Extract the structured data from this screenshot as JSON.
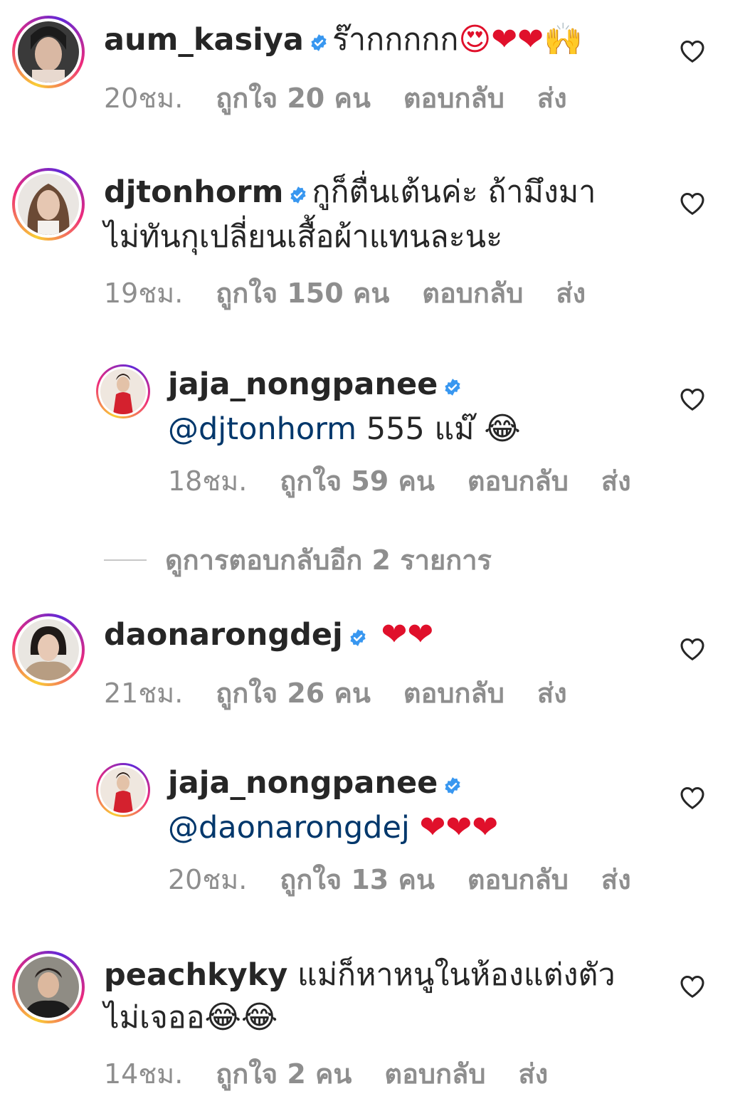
{
  "comments": [
    {
      "username": "aum_kasiya",
      "text": "ร๊ากกกกก",
      "emojis": "😍❤❤🙌",
      "time": "20ชม.",
      "likes": "ถูกใจ 20 คน",
      "reply": "ตอบกลับ",
      "send": "ส่ง"
    },
    {
      "username": "djtonhorm",
      "text_line1": "กูก็ตื่นเต้นค่ะ ถ้ามึงมา",
      "text_line2": "ไม่ทันกุเปลี่ยนเสื้อผ้าแทนละนะ",
      "time": "19ชม.",
      "likes": "ถูกใจ 150 คน",
      "reply": "ตอบกลับ",
      "send": "ส่ง"
    },
    {
      "username": "jaja_nongpanee",
      "mention": "@djtonhorm",
      "text": " 555 แม๊",
      "emojis": "😂",
      "time": "18ชม.",
      "likes": "ถูกใจ 59 คน",
      "reply": "ตอบกลับ",
      "send": "ส่ง"
    },
    {
      "username": "daonarongdej",
      "emojis": "❤❤",
      "time": "21ชม.",
      "likes": "ถูกใจ 26 คน",
      "reply": "ตอบกลับ",
      "send": "ส่ง"
    },
    {
      "username": "jaja_nongpanee",
      "mention": "@daonarongdej",
      "emojis": "❤❤❤",
      "time": "20ชม.",
      "likes": "ถูกใจ 13 คน",
      "reply": "ตอบกลับ",
      "send": "ส่ง"
    },
    {
      "username": "peachkyky",
      "text_line1": "แม่ก็หาหนูในห้องแต่งตัว",
      "text_line2": "ไม่เจออ",
      "emojis": "😂😂",
      "time": "14ชม.",
      "likes": "ถูกใจ 2 คน",
      "reply": "ตอบกลับ",
      "send": "ส่ง"
    }
  ],
  "view_more_replies": "ดูการตอบกลับอีก 2 รายการ",
  "colors": {
    "verified": "#3897f0",
    "mention": "#00376b",
    "meta": "#8e8e8e",
    "heart": "#e0102b"
  }
}
